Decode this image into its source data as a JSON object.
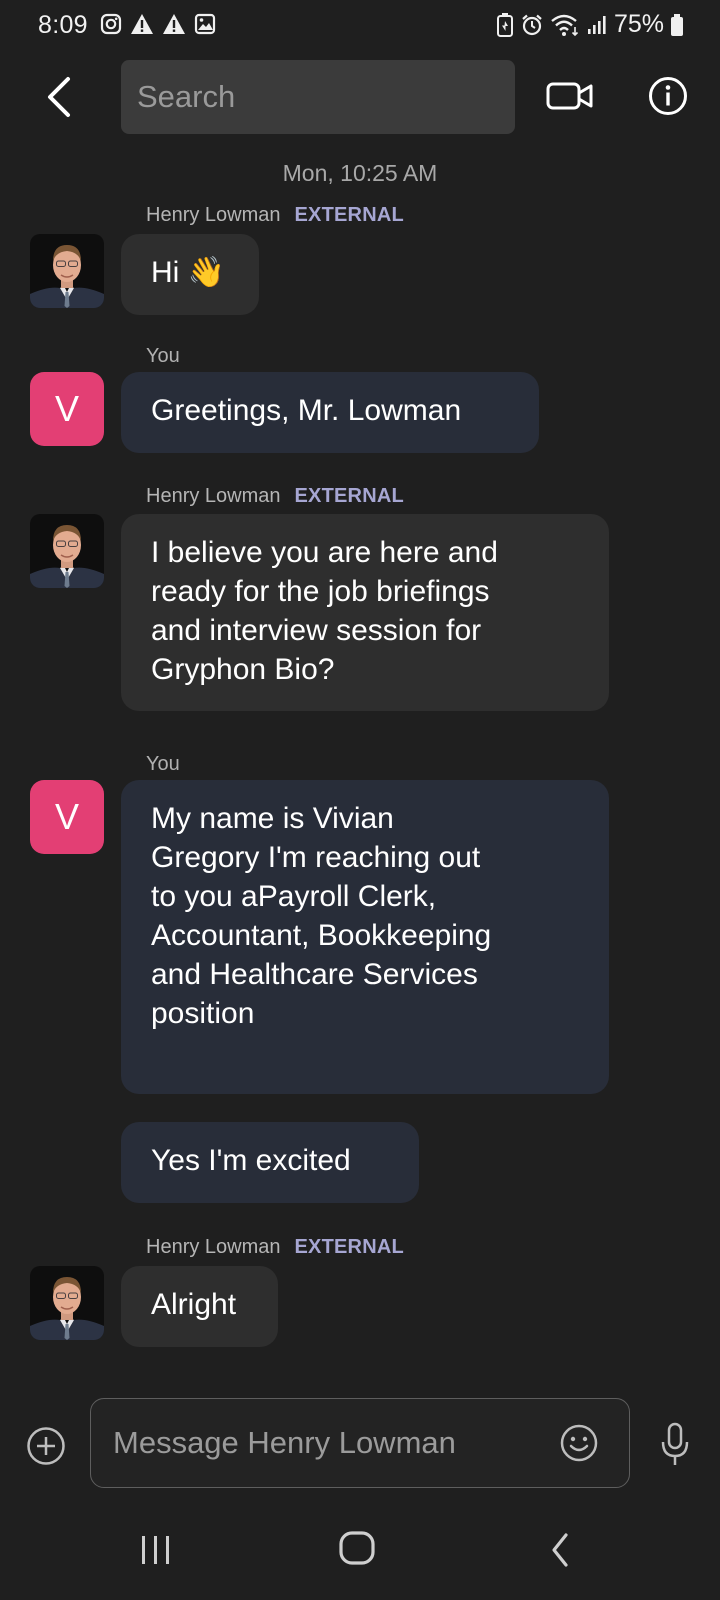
{
  "status_bar": {
    "time": "8:09",
    "battery": "75%",
    "icons": [
      "instagram-icon",
      "warning-icon",
      "warning-icon",
      "image-icon",
      "battery-saver-icon",
      "alarm-icon",
      "wifi-icon",
      "signal-icon",
      "battery-icon"
    ]
  },
  "header": {
    "search_placeholder": "Search",
    "icons": [
      "back-arrow-icon",
      "video-call-icon",
      "info-icon"
    ]
  },
  "conversation": {
    "timestamp": "Mon, 10:25 AM",
    "external_tag": "EXTERNAL",
    "messages": [
      {
        "sender": "Henry Lowman",
        "direction": "incoming",
        "text": "Hi 👋"
      },
      {
        "sender": "You",
        "direction": "outgoing",
        "avatar_letter": "V",
        "text": "Greetings,  Mr. Lowman"
      },
      {
        "sender": "Henry Lowman",
        "direction": "incoming",
        "text": "I believe you are here and\nready for the job briefings\nand interview session for\nGryphon Bio?"
      },
      {
        "sender": "You",
        "direction": "outgoing",
        "avatar_letter": "V",
        "text": "My name is Vivian\nGregory I'm reaching out\nto you aPayroll Clerk,\nAccountant, Bookkeeping\nand Healthcare Services\nposition"
      },
      {
        "sender": "You",
        "direction": "outgoing",
        "text": "Yes I'm excited"
      },
      {
        "sender": "Henry Lowman",
        "direction": "incoming",
        "text": "Alright"
      }
    ]
  },
  "composer": {
    "placeholder": "Message Henry Lowman",
    "icons": [
      "add-icon",
      "emoji-icon",
      "microphone-icon"
    ]
  },
  "colors": {
    "background": "#1f1f1f",
    "incoming_bubble": "#2e2e2e",
    "outgoing_bubble": "#282d39",
    "user_avatar": "#e33f74",
    "external_tag": "#a6a6d2"
  }
}
